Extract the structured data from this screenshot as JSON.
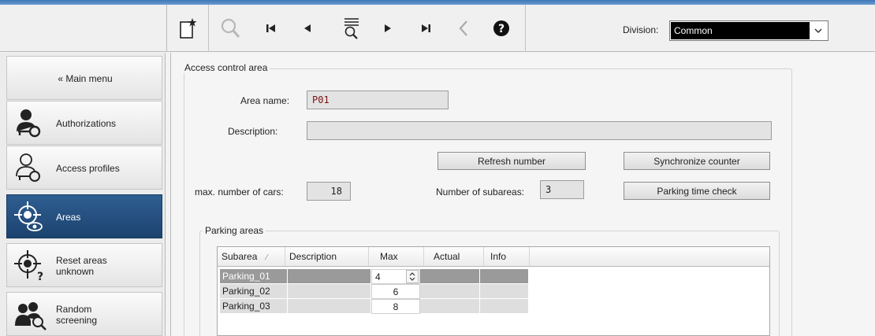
{
  "toolbar": {
    "icons": [
      "new-record-icon",
      "search-icon",
      "first-record-icon",
      "previous-record-icon",
      "filter-search-icon",
      "next-record-icon",
      "last-record-icon",
      "back-icon",
      "help-icon"
    ],
    "division_label": "Division:",
    "division_value": "Common"
  },
  "sidebar": {
    "main_menu": "« Main menu",
    "items": [
      {
        "label": "Authorizations",
        "icon": "key-person-icon"
      },
      {
        "label": "Access profiles",
        "icon": "key-person-outline-icon"
      },
      {
        "label": "Areas",
        "icon": "target-eye-icon",
        "active": true
      },
      {
        "label": "Reset areas unknown",
        "icon": "target-question-icon"
      },
      {
        "label": "Random screening",
        "icon": "people-search-icon"
      }
    ]
  },
  "form": {
    "group_title": "Access control area",
    "area_name_label": "Area name:",
    "area_name_value": "P01",
    "description_label": "Description:",
    "description_value": "",
    "refresh_number_button": "Refresh number",
    "synchronize_counter_button": "Synchronize counter",
    "max_cars_label": "max. number of cars:",
    "max_cars_value": "18",
    "subareas_label": "Number of subareas:",
    "subareas_value": "3",
    "parking_time_check_button": "Parking time check"
  },
  "parking": {
    "group_title": "Parking areas",
    "columns": [
      "Subarea",
      "Description",
      "Max",
      "Actual",
      "Info"
    ],
    "rows": [
      {
        "subarea": "Parking_01",
        "description": "",
        "max": "4",
        "actual": "",
        "info": ""
      },
      {
        "subarea": "Parking_02",
        "description": "",
        "max": "6",
        "actual": "",
        "info": ""
      },
      {
        "subarea": "Parking_03",
        "description": "",
        "max": "8",
        "actual": "",
        "info": ""
      }
    ]
  },
  "colors": {
    "active_nav": "#1f4a7c",
    "top_strip": "#3f78b6",
    "area_name_text": "#7a1010"
  }
}
